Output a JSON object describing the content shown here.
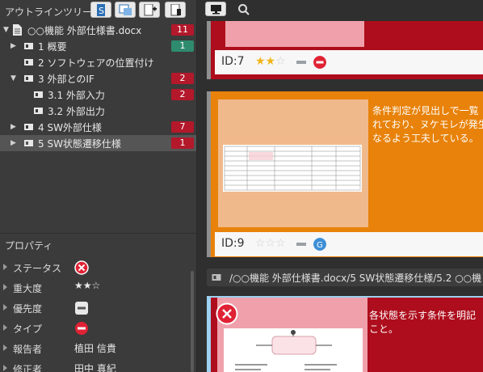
{
  "outline": {
    "title": "アウトラインツリー",
    "toolbar": [
      "s-doc-icon",
      "view-icon",
      "add-doc-icon",
      "bookmark-doc-icon"
    ],
    "document": {
      "label": "○○機能 外部仕様書.docx",
      "count": "11"
    },
    "items": [
      {
        "label": "1 概要",
        "count": "1",
        "badge": "green",
        "chevron": "▶",
        "level": 1
      },
      {
        "label": "2 ソフトウェアの位置付け",
        "count": "",
        "badge": "",
        "chevron": "",
        "level": 1
      },
      {
        "label": "3 外部とのIF",
        "count": "2",
        "badge": "red",
        "chevron": "▼",
        "level": 1
      },
      {
        "label": "3.1 外部入力",
        "count": "2",
        "badge": "red",
        "chevron": "",
        "level": 2
      },
      {
        "label": "3.2 外部出力",
        "count": "",
        "badge": "",
        "chevron": "",
        "level": 2
      },
      {
        "label": "4 SW外部仕様",
        "count": "7",
        "badge": "red",
        "chevron": "▶",
        "level": 1
      },
      {
        "label": "5 SW状態遷移仕様",
        "count": "1",
        "badge": "red",
        "chevron": "▶",
        "level": 1,
        "selected": true
      }
    ]
  },
  "properties": {
    "title": "プロパティ",
    "status_label": "ステータス",
    "severity_label": "重大度",
    "severity_stars": "★★☆",
    "priority_label": "優先度",
    "type_label": "タイプ",
    "reporter_label": "報告者",
    "reporter_value": "植田 信貴",
    "assignee_label": "修正者",
    "assignee_value": "田中 真紀"
  },
  "cards": [
    {
      "id": "ID:7",
      "stars_on": "★★",
      "stars_off": "☆",
      "status": "stop-icon",
      "description": ""
    },
    {
      "id": "ID:9",
      "stars_on": "",
      "stars_off": "☆☆☆",
      "status": "g-icon",
      "description_lines": [
        "条件判定が見出しで一覧",
        "れており、ヌケモレが発生し",
        "なるよう工夫している。"
      ]
    },
    {
      "id": "",
      "status": "error-icon",
      "description_lines": [
        "各状態を示す条件を明記",
        "こと。"
      ]
    }
  ],
  "path": "/○○機能 外部仕様書.docx/5 SW状態遷移仕様/5.2 ○○機",
  "colors": {
    "red": "#b3182b",
    "green": "#2e8b6e",
    "orange": "#e8820a",
    "star": "#f2b51a",
    "selection": "#9ed0f0"
  }
}
